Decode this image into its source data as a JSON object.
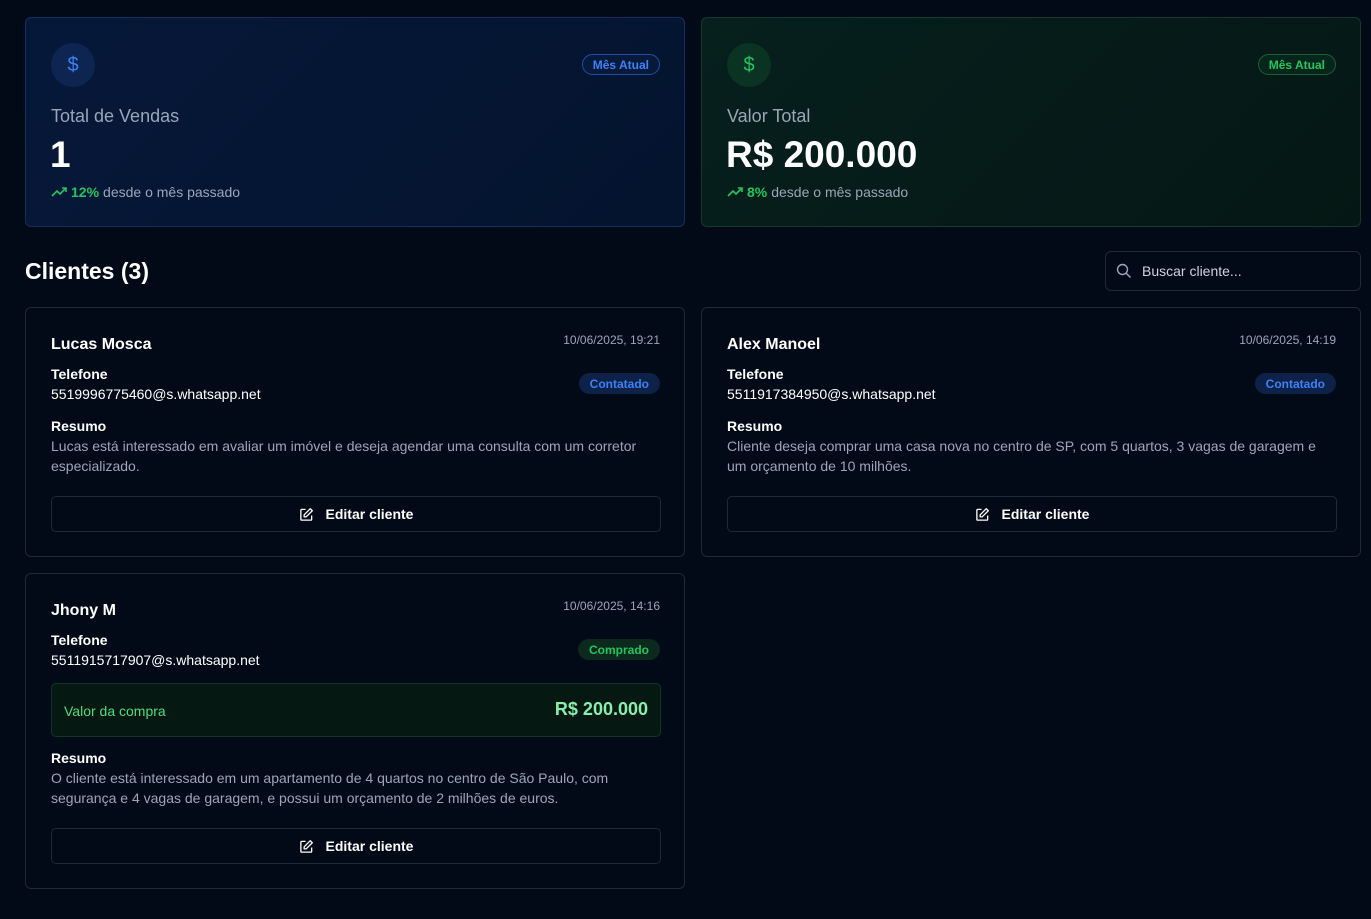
{
  "stats": [
    {
      "label": "Total de Vendas",
      "value": "1",
      "badge": "Mês Atual",
      "icon": "dollar-icon",
      "trend_pct": "12%",
      "trend_text": "desde o mês passado",
      "accent": "#3b82f6"
    },
    {
      "label": "Valor Total",
      "value": "R$ 200.000",
      "badge": "Mês Atual",
      "icon": "dollar-icon",
      "trend_pct": "8%",
      "trend_text": "desde o mês passado",
      "accent": "#22c55e"
    }
  ],
  "clients_section": {
    "title": "Clientes (3)",
    "search_placeholder": "Buscar cliente..."
  },
  "clients": [
    {
      "name": "Lucas Mosca",
      "date": "10/06/2025, 19:21",
      "phone_label": "Telefone",
      "phone": "5519996775460@s.whatsapp.net",
      "status": "Contatado",
      "summary_label": "Resumo",
      "summary": "Lucas está interessado em avaliar um imóvel e deseja agendar uma consulta com um corretor especializado.",
      "edit_label": "Editar cliente"
    },
    {
      "name": "Alex Manoel",
      "date": "10/06/2025, 14:19",
      "phone_label": "Telefone",
      "phone": "5511917384950@s.whatsapp.net",
      "status": "Contatado",
      "summary_label": "Resumo",
      "summary": "Cliente deseja comprar uma casa nova no centro de SP, com 5 quartos, 3 vagas de garagem e um orçamento de 10 milhões.",
      "edit_label": "Editar cliente"
    },
    {
      "name": "Jhony M",
      "date": "10/06/2025, 14:16",
      "phone_label": "Telefone",
      "phone": "5511915717907@s.whatsapp.net",
      "status": "Comprado",
      "purchase_label": "Valor da compra",
      "purchase_value": "R$ 200.000",
      "summary_label": "Resumo",
      "summary": "O cliente está interessado em um apartamento de 4 quartos no centro de São Paulo, com segurança e 4 vagas de garagem, e possui um orçamento de 2 milhões de euros.",
      "edit_label": "Editar cliente"
    }
  ],
  "colors": {
    "background": "#030a17",
    "status_contatado": "#3b82f6",
    "status_comprado": "#22c55e"
  }
}
